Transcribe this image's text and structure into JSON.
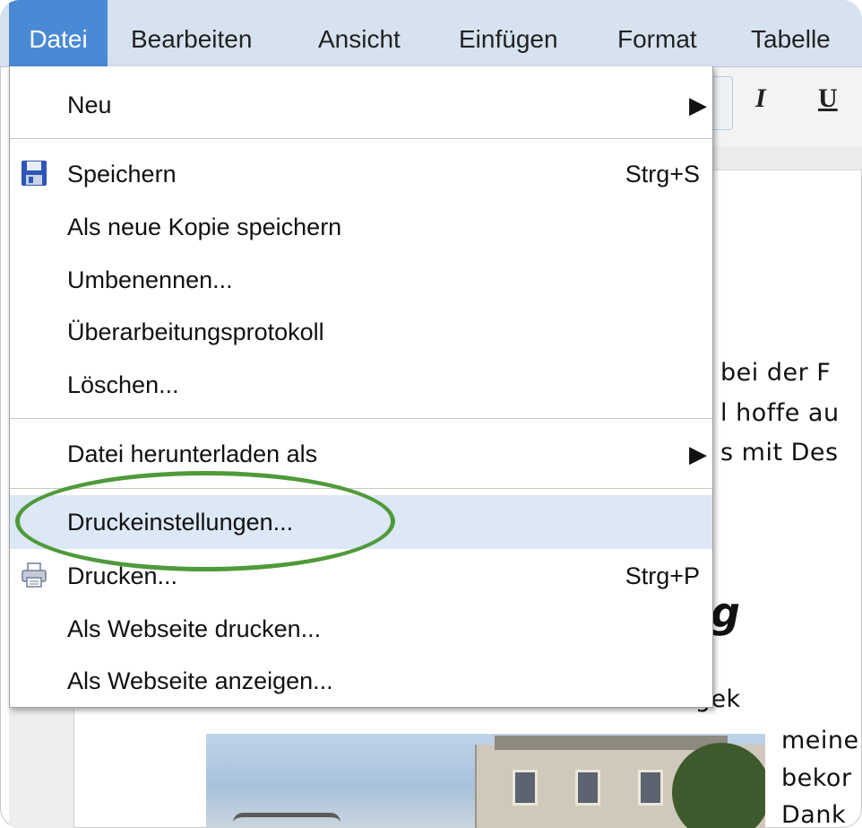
{
  "menubar": {
    "items": [
      "Datei",
      "Bearbeiten",
      "Ansicht",
      "Einfügen",
      "Format",
      "Tabelle"
    ],
    "active": "Datei"
  },
  "toolbar": {
    "italic": "I",
    "underline": "U"
  },
  "file_menu": {
    "new": "Neu",
    "save": "Speichern",
    "save_shortcut": "Strg+S",
    "save_copy": "Als neue Kopie speichern",
    "rename": "Umbenennen...",
    "revision_history": "Überarbeitungsprotokoll",
    "delete": "Löschen...",
    "download_as": "Datei herunterladen als",
    "print_settings": "Druckeinstellungen...",
    "print": "Drucken...",
    "print_shortcut": "Strg+P",
    "print_webpage": "Als Webseite drucken...",
    "view_webpage": "Als Webseite anzeigen..."
  },
  "document": {
    "line1": "bei der F",
    "line2": "l hoffe au",
    "line3": "s mit Des",
    "heading": "g",
    "line4": "Hallo liebe Freunde! Nun hat doch alles gek",
    "line5": "meine",
    "line6": "bekor",
    "line7": "Dank"
  },
  "colors": {
    "menubar_bg": "#d6e2ef",
    "active_menu": "#4a89d4",
    "highlight_row": "#dde8f6",
    "annotation": "#4f9a3a"
  },
  "icons": {
    "save": "floppy-disk-icon",
    "print": "printer-icon",
    "submenu": "submenu-arrow-icon"
  }
}
